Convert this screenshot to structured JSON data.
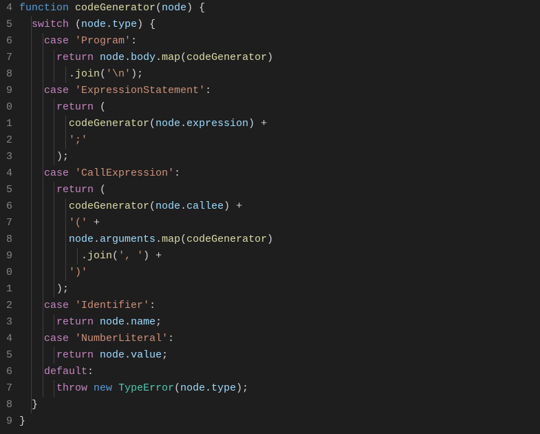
{
  "language": "javascript",
  "theme": "dark",
  "line_start": 4,
  "colors": {
    "background": "#1e1e1e",
    "gutter_fg": "#858585",
    "keyword": "#569cd6",
    "control": "#c586c0",
    "function": "#dcdcaa",
    "variable": "#9cdcfe",
    "string": "#ce9178",
    "class": "#4ec9b0",
    "default": "#d4d4d4"
  },
  "lines": [
    {
      "num": "4",
      "tokens": [
        {
          "t": "function ",
          "c": "kw"
        },
        {
          "t": "codeGenerator",
          "c": "fn"
        },
        {
          "t": "(",
          "c": "pun"
        },
        {
          "t": "node",
          "c": "va"
        },
        {
          "t": ") {",
          "c": "pun"
        }
      ],
      "indent": 0
    },
    {
      "num": "5",
      "tokens": [
        {
          "t": "  ",
          "c": "pun"
        },
        {
          "t": "switch",
          "c": "ctl"
        },
        {
          "t": " (",
          "c": "pun"
        },
        {
          "t": "node",
          "c": "va"
        },
        {
          "t": ".",
          "c": "pun"
        },
        {
          "t": "type",
          "c": "va"
        },
        {
          "t": ") {",
          "c": "pun"
        }
      ]
    },
    {
      "num": "6",
      "tokens": [
        {
          "t": "    ",
          "c": "pun"
        },
        {
          "t": "case",
          "c": "ctl"
        },
        {
          "t": " ",
          "c": "pun"
        },
        {
          "t": "'Program'",
          "c": "str"
        },
        {
          "t": ":",
          "c": "pun"
        }
      ]
    },
    {
      "num": "7",
      "tokens": [
        {
          "t": "      ",
          "c": "pun"
        },
        {
          "t": "return",
          "c": "ctl"
        },
        {
          "t": " ",
          "c": "pun"
        },
        {
          "t": "node",
          "c": "va"
        },
        {
          "t": ".",
          "c": "pun"
        },
        {
          "t": "body",
          "c": "va"
        },
        {
          "t": ".",
          "c": "pun"
        },
        {
          "t": "map",
          "c": "fn"
        },
        {
          "t": "(",
          "c": "pun"
        },
        {
          "t": "codeGenerator",
          "c": "fn"
        },
        {
          "t": ")",
          "c": "pun"
        }
      ]
    },
    {
      "num": "8",
      "tokens": [
        {
          "t": "        .",
          "c": "pun"
        },
        {
          "t": "join",
          "c": "fn"
        },
        {
          "t": "(",
          "c": "pun"
        },
        {
          "t": "'\\n'",
          "c": "str"
        },
        {
          "t": ");",
          "c": "pun"
        }
      ]
    },
    {
      "num": "9",
      "tokens": [
        {
          "t": "    ",
          "c": "pun"
        },
        {
          "t": "case",
          "c": "ctl"
        },
        {
          "t": " ",
          "c": "pun"
        },
        {
          "t": "'ExpressionStatement'",
          "c": "str"
        },
        {
          "t": ":",
          "c": "pun"
        }
      ]
    },
    {
      "num": "0",
      "tokens": [
        {
          "t": "      ",
          "c": "pun"
        },
        {
          "t": "return",
          "c": "ctl"
        },
        {
          "t": " (",
          "c": "pun"
        }
      ]
    },
    {
      "num": "1",
      "tokens": [
        {
          "t": "        ",
          "c": "pun"
        },
        {
          "t": "codeGenerator",
          "c": "fn"
        },
        {
          "t": "(",
          "c": "pun"
        },
        {
          "t": "node",
          "c": "va"
        },
        {
          "t": ".",
          "c": "pun"
        },
        {
          "t": "expression",
          "c": "va"
        },
        {
          "t": ") +",
          "c": "pun"
        }
      ]
    },
    {
      "num": "2",
      "tokens": [
        {
          "t": "        ",
          "c": "pun"
        },
        {
          "t": "';'",
          "c": "str"
        }
      ]
    },
    {
      "num": "3",
      "tokens": [
        {
          "t": "      );",
          "c": "pun"
        }
      ]
    },
    {
      "num": "4",
      "tokens": [
        {
          "t": "    ",
          "c": "pun"
        },
        {
          "t": "case",
          "c": "ctl"
        },
        {
          "t": " ",
          "c": "pun"
        },
        {
          "t": "'CallExpression'",
          "c": "str"
        },
        {
          "t": ":",
          "c": "pun"
        }
      ]
    },
    {
      "num": "5",
      "tokens": [
        {
          "t": "      ",
          "c": "pun"
        },
        {
          "t": "return",
          "c": "ctl"
        },
        {
          "t": " (",
          "c": "pun"
        }
      ]
    },
    {
      "num": "6",
      "tokens": [
        {
          "t": "        ",
          "c": "pun"
        },
        {
          "t": "codeGenerator",
          "c": "fn"
        },
        {
          "t": "(",
          "c": "pun"
        },
        {
          "t": "node",
          "c": "va"
        },
        {
          "t": ".",
          "c": "pun"
        },
        {
          "t": "callee",
          "c": "va"
        },
        {
          "t": ") +",
          "c": "pun"
        }
      ]
    },
    {
      "num": "7",
      "tokens": [
        {
          "t": "        ",
          "c": "pun"
        },
        {
          "t": "'('",
          "c": "str"
        },
        {
          "t": " +",
          "c": "pun"
        }
      ]
    },
    {
      "num": "8",
      "tokens": [
        {
          "t": "        ",
          "c": "pun"
        },
        {
          "t": "node",
          "c": "va"
        },
        {
          "t": ".",
          "c": "pun"
        },
        {
          "t": "arguments",
          "c": "va"
        },
        {
          "t": ".",
          "c": "pun"
        },
        {
          "t": "map",
          "c": "fn"
        },
        {
          "t": "(",
          "c": "pun"
        },
        {
          "t": "codeGenerator",
          "c": "fn"
        },
        {
          "t": ")",
          "c": "pun"
        }
      ]
    },
    {
      "num": "9",
      "tokens": [
        {
          "t": "          .",
          "c": "pun"
        },
        {
          "t": "join",
          "c": "fn"
        },
        {
          "t": "(",
          "c": "pun"
        },
        {
          "t": "', '",
          "c": "str"
        },
        {
          "t": ") +",
          "c": "pun"
        }
      ]
    },
    {
      "num": "0",
      "tokens": [
        {
          "t": "        ",
          "c": "pun"
        },
        {
          "t": "')'",
          "c": "str"
        }
      ]
    },
    {
      "num": "1",
      "tokens": [
        {
          "t": "      );",
          "c": "pun"
        }
      ]
    },
    {
      "num": "2",
      "tokens": [
        {
          "t": "    ",
          "c": "pun"
        },
        {
          "t": "case",
          "c": "ctl"
        },
        {
          "t": " ",
          "c": "pun"
        },
        {
          "t": "'Identifier'",
          "c": "str"
        },
        {
          "t": ":",
          "c": "pun"
        }
      ]
    },
    {
      "num": "3",
      "tokens": [
        {
          "t": "      ",
          "c": "pun"
        },
        {
          "t": "return",
          "c": "ctl"
        },
        {
          "t": " ",
          "c": "pun"
        },
        {
          "t": "node",
          "c": "va"
        },
        {
          "t": ".",
          "c": "pun"
        },
        {
          "t": "name",
          "c": "va"
        },
        {
          "t": ";",
          "c": "pun"
        }
      ]
    },
    {
      "num": "4",
      "tokens": [
        {
          "t": "    ",
          "c": "pun"
        },
        {
          "t": "case",
          "c": "ctl"
        },
        {
          "t": " ",
          "c": "pun"
        },
        {
          "t": "'NumberLiteral'",
          "c": "str"
        },
        {
          "t": ":",
          "c": "pun"
        }
      ]
    },
    {
      "num": "5",
      "tokens": [
        {
          "t": "      ",
          "c": "pun"
        },
        {
          "t": "return",
          "c": "ctl"
        },
        {
          "t": " ",
          "c": "pun"
        },
        {
          "t": "node",
          "c": "va"
        },
        {
          "t": ".",
          "c": "pun"
        },
        {
          "t": "value",
          "c": "va"
        },
        {
          "t": ";",
          "c": "pun"
        }
      ]
    },
    {
      "num": "6",
      "tokens": [
        {
          "t": "    ",
          "c": "pun"
        },
        {
          "t": "default",
          "c": "ctl"
        },
        {
          "t": ":",
          "c": "pun"
        }
      ]
    },
    {
      "num": "7",
      "tokens": [
        {
          "t": "      ",
          "c": "pun"
        },
        {
          "t": "throw",
          "c": "ctl"
        },
        {
          "t": " ",
          "c": "pun"
        },
        {
          "t": "new",
          "c": "kw"
        },
        {
          "t": " ",
          "c": "pun"
        },
        {
          "t": "TypeError",
          "c": "cls"
        },
        {
          "t": "(",
          "c": "pun"
        },
        {
          "t": "node",
          "c": "va"
        },
        {
          "t": ".",
          "c": "pun"
        },
        {
          "t": "type",
          "c": "va"
        },
        {
          "t": ");",
          "c": "pun"
        }
      ]
    },
    {
      "num": "8",
      "tokens": [
        {
          "t": "  }",
          "c": "pun"
        }
      ]
    },
    {
      "num": "9",
      "tokens": [
        {
          "t": "}",
          "c": "pun"
        }
      ]
    }
  ]
}
